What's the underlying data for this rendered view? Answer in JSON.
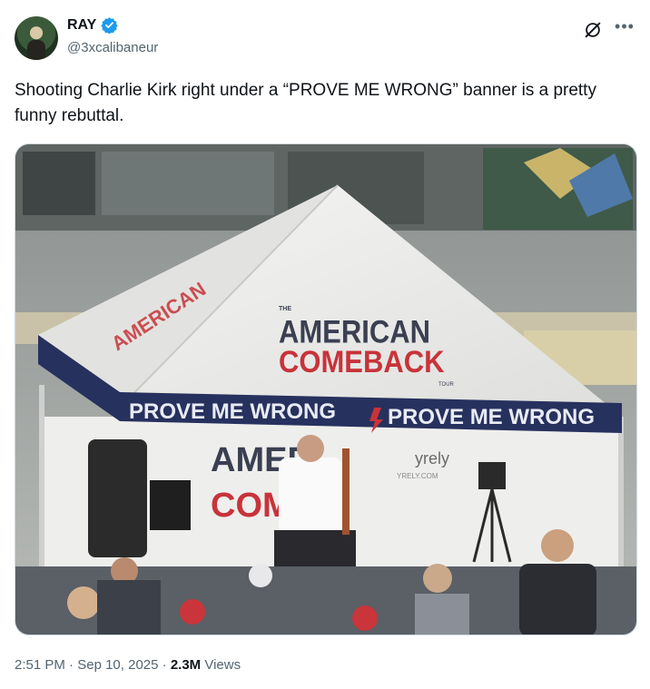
{
  "author": {
    "display_name": "RAY",
    "handle": "@3xcalibaneur",
    "verified": true,
    "verified_color": "#1d9bf0"
  },
  "tweet": {
    "text": "Shooting Charlie Kirk right under a “PROVE ME WRONG” banner is a pretty funny rebuttal."
  },
  "media": {
    "tent_roof_main_1": "AMERICAN",
    "tent_roof_main_2": "COMEBACK",
    "tent_roof_small_top": "THE",
    "tent_roof_small_bottom": "TOUR",
    "banner_left": "PROVE ME WRONG",
    "banner_right": "PROVE ME WRONG",
    "backdrop_text_1": "AMER",
    "backdrop_text_2": "COME",
    "sponsor_text": "yrely",
    "sponsor_url": "YRELY.COM"
  },
  "meta": {
    "time": "2:51 PM",
    "separator": " · ",
    "date": "Sep 10, 2025",
    "views_count": "2.3M",
    "views_label": " Views"
  },
  "colors": {
    "banner_navy": "#27315e",
    "tent_red": "#c8333a",
    "tent_white": "#f3f3f1"
  },
  "icons": {
    "grok": "grok-icon",
    "more": "more-icon",
    "verified": "verified-badge-icon"
  }
}
